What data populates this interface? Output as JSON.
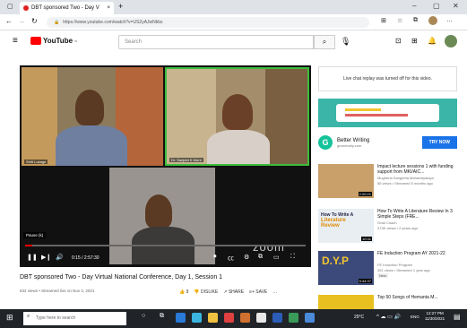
{
  "browser": {
    "tab_title": "DBT sponsored Two - Day V",
    "url": "https://www.youtube.com/watch?v=US2yAJwNkbs"
  },
  "youtube": {
    "logo": "YouTube",
    "country_code": "IN",
    "search_placeholder": "Search"
  },
  "video": {
    "tiles": [
      {
        "label": "Shift Lokage"
      },
      {
        "label": "Dr. Sanjeet K More"
      },
      {
        "label": ""
      }
    ],
    "pause_label": "Pause (k)",
    "time": "0:15 / 2:57:30",
    "zoom_watermark": "zoom",
    "title": "DBT sponsored Two - Day Virtual National Conference, Day 1, Session 1",
    "meta": "532 views • Streamed live on Nov 2, 2021",
    "like_count": "9",
    "dislike_label": "DISLIKE",
    "share_label": "SHARE",
    "save_label": "SAVE"
  },
  "sidebar": {
    "chat_notice": "Live chat replay was turned off for this video.",
    "ad": {
      "name": "Better Writing",
      "domain": "grammarly.com",
      "button": "TRY NOW"
    },
    "recs": [
      {
        "title": "Impact lecture sessions 1 with funding support from MKI/AIC...",
        "channel": "Mugheria Sangeeta Mahavidyalaya",
        "meta": "56 views • Streamed 5 months ago",
        "duration": "2:20:21"
      },
      {
        "title": "How To Write A Literature Review In 3 Simple Steps (FRE...",
        "channel": "Grad Coach",
        "meta": "373K views • 2 years ago",
        "duration": "10:31",
        "thumb_text_1": "How To Write A",
        "thumb_text_2": "Literature Review"
      },
      {
        "title": "FE Induction Program AY 2021-22",
        "channel": "FE Induction Program",
        "meta": "351 views • Streamed 1 year ago",
        "duration": "5:44:37",
        "badge": "New",
        "thumb_text": "D.Y.P"
      },
      {
        "title": "Top 50 Songs of Hemanta M...",
        "channel": "",
        "meta": "",
        "duration": ""
      }
    ]
  },
  "taskbar": {
    "search_placeholder": "Type here to search",
    "weather": "29°C",
    "time": "12:27 PM",
    "date": "11/30/2021",
    "lang": "ENG"
  },
  "colors": {
    "yt_red": "#ff0000",
    "active_speaker": "#3cbd3c",
    "try_now": "#1a73e8",
    "taskbar": "#202428"
  }
}
